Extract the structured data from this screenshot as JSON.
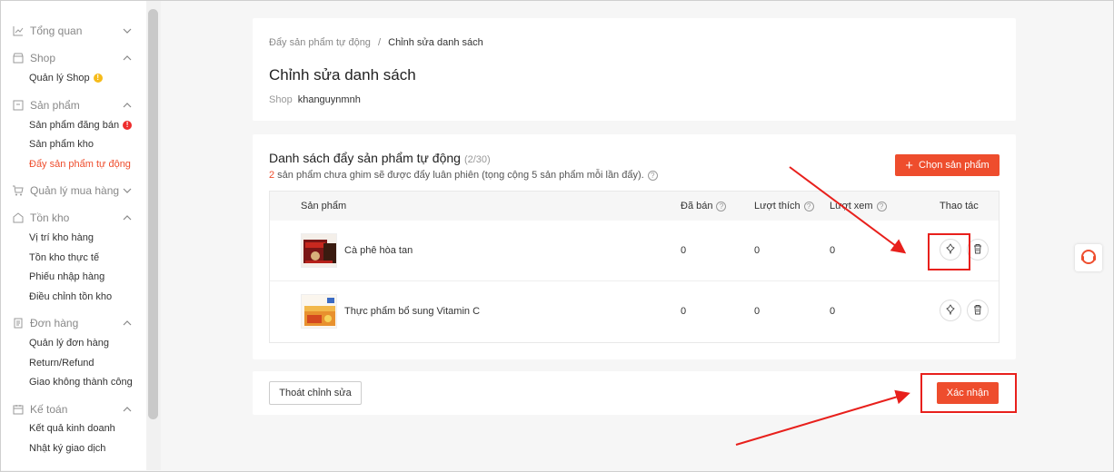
{
  "sidebar": {
    "groups": [
      {
        "label": "Tổng quan",
        "icon": "chart-line-icon",
        "expanded": false,
        "items": []
      },
      {
        "label": "Shop",
        "icon": "shop-icon",
        "expanded": true,
        "items": [
          {
            "label": "Quản lý Shop",
            "badge": "!"
          }
        ]
      },
      {
        "label": "Sản phẩm",
        "icon": "product-icon",
        "expanded": true,
        "items": [
          {
            "label": "Sản phẩm đăng bán",
            "badge": "!"
          },
          {
            "label": "Sản phẩm kho"
          },
          {
            "label": "Đẩy sản phẩm tự động",
            "active": true
          }
        ]
      },
      {
        "label": "Quản lý mua hàng",
        "icon": "cart-icon",
        "expanded": false,
        "items": []
      },
      {
        "label": "Tồn kho",
        "icon": "warehouse-icon",
        "expanded": true,
        "items": [
          {
            "label": "Vị trí kho hàng"
          },
          {
            "label": "Tồn kho thực tế"
          },
          {
            "label": "Phiếu nhập hàng"
          },
          {
            "label": "Điều chỉnh tồn kho"
          }
        ]
      },
      {
        "label": "Đơn hàng",
        "icon": "order-icon",
        "expanded": true,
        "items": [
          {
            "label": "Quản lý đơn hàng"
          },
          {
            "label": "Return/Refund"
          },
          {
            "label": "Giao không thành công"
          }
        ]
      },
      {
        "label": "Kế toán",
        "icon": "accounting-icon",
        "expanded": true,
        "items": [
          {
            "label": "Kết quả kinh doanh"
          },
          {
            "label": "Nhật ký giao dịch"
          }
        ]
      }
    ]
  },
  "header": {
    "breadcrumb_parent": "Đẩy sản phẩm tự động",
    "breadcrumb_sep": "/",
    "breadcrumb_current": "Chỉnh sửa danh sách",
    "title": "Chỉnh sửa danh sách",
    "shop_label": "Shop",
    "shop_value": "khanguynmnh"
  },
  "list": {
    "title": "Danh sách đẩy sản phẩm tự động",
    "count": "(2/30)",
    "note_num": "2",
    "note_text": " sản phẩm chưa ghim sẽ được đẩy luân phiên (tọng cộng 5 sản phẩm mỗi lần đẩy).",
    "choose_button": "Chọn sản phẩm",
    "columns": {
      "product": "Sản phẩm",
      "sold": "Đã bán",
      "likes": "Lượt thích",
      "views": "Lượt xem",
      "actions": "Thao tác"
    },
    "rows": [
      {
        "name": "Cà phê hòa tan",
        "sold": "0",
        "likes": "0",
        "views": "0"
      },
      {
        "name": "Thực phẩm bổ sung Vitamin C",
        "sold": "0",
        "likes": "0",
        "views": "0"
      }
    ]
  },
  "footer": {
    "exit_button": "Thoát chỉnh sửa",
    "confirm_button": "Xác nhận"
  },
  "colors": {
    "accent": "#ee4d2d",
    "annotation": "#e8201c"
  }
}
